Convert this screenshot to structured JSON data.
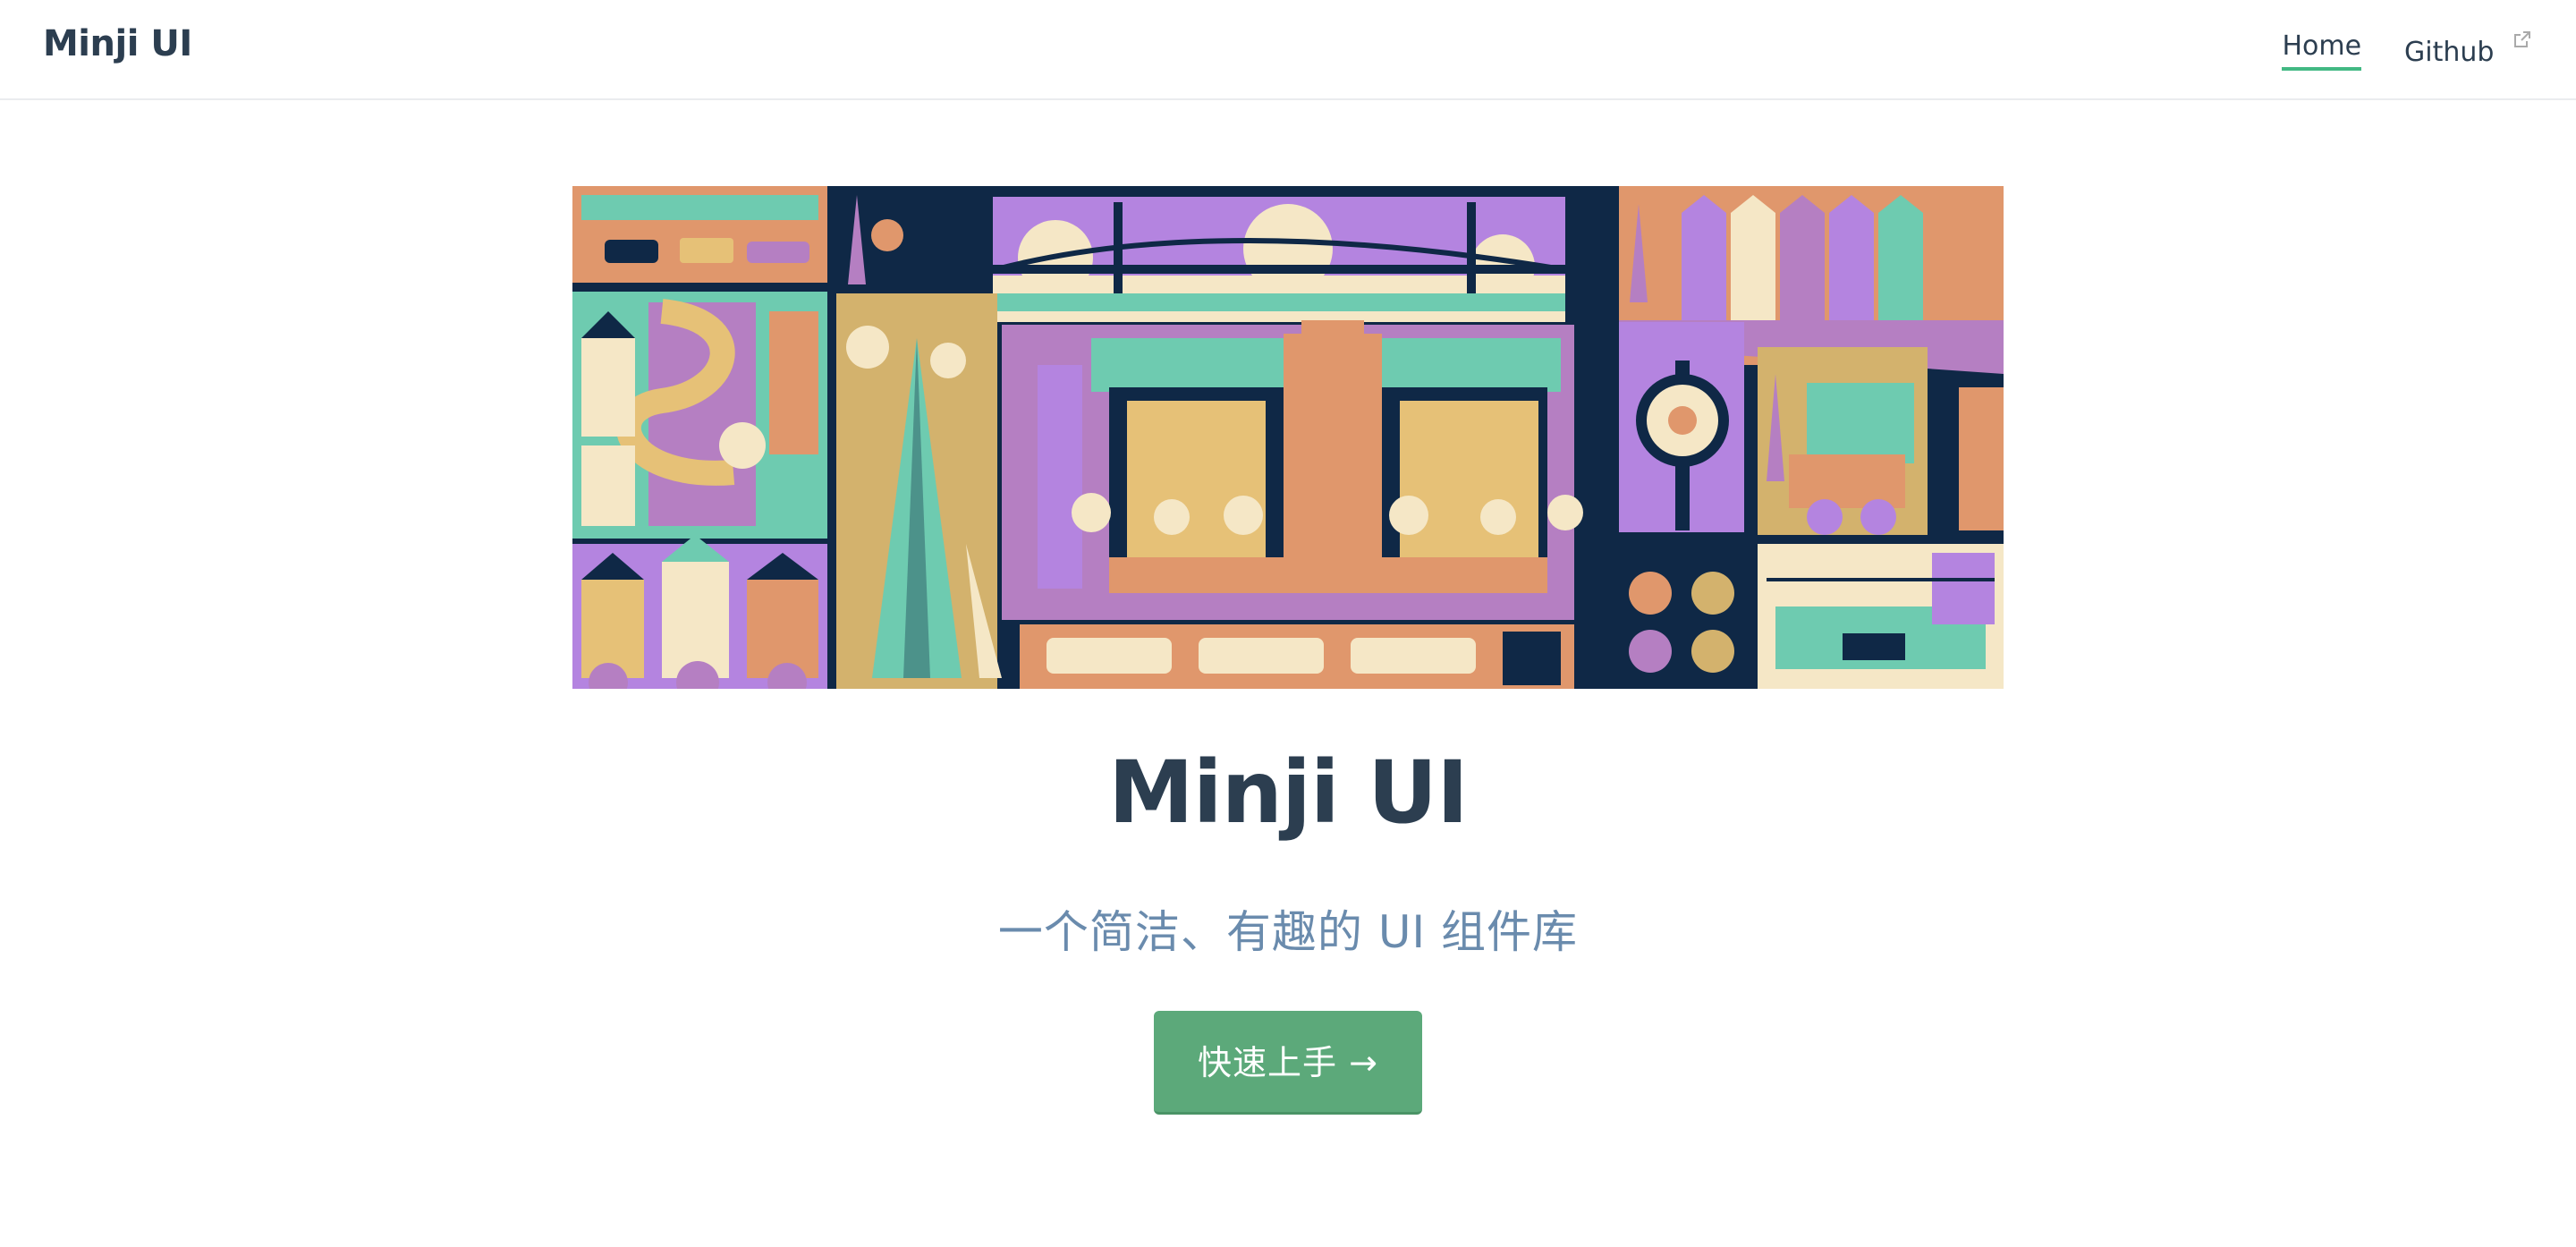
{
  "navbar": {
    "brand": "Minji UI",
    "links": [
      {
        "label": "Home",
        "active": true
      },
      {
        "label": "Github",
        "external": true
      }
    ]
  },
  "hero": {
    "title": "Minji UI",
    "description": "一个简洁、有趣的 UI 组件库",
    "cta_label": "快速上手 →"
  },
  "colors": {
    "accent": "#42b983",
    "button": "#5ca97a",
    "text": "#2c3e50",
    "description": "#6a8bad"
  }
}
